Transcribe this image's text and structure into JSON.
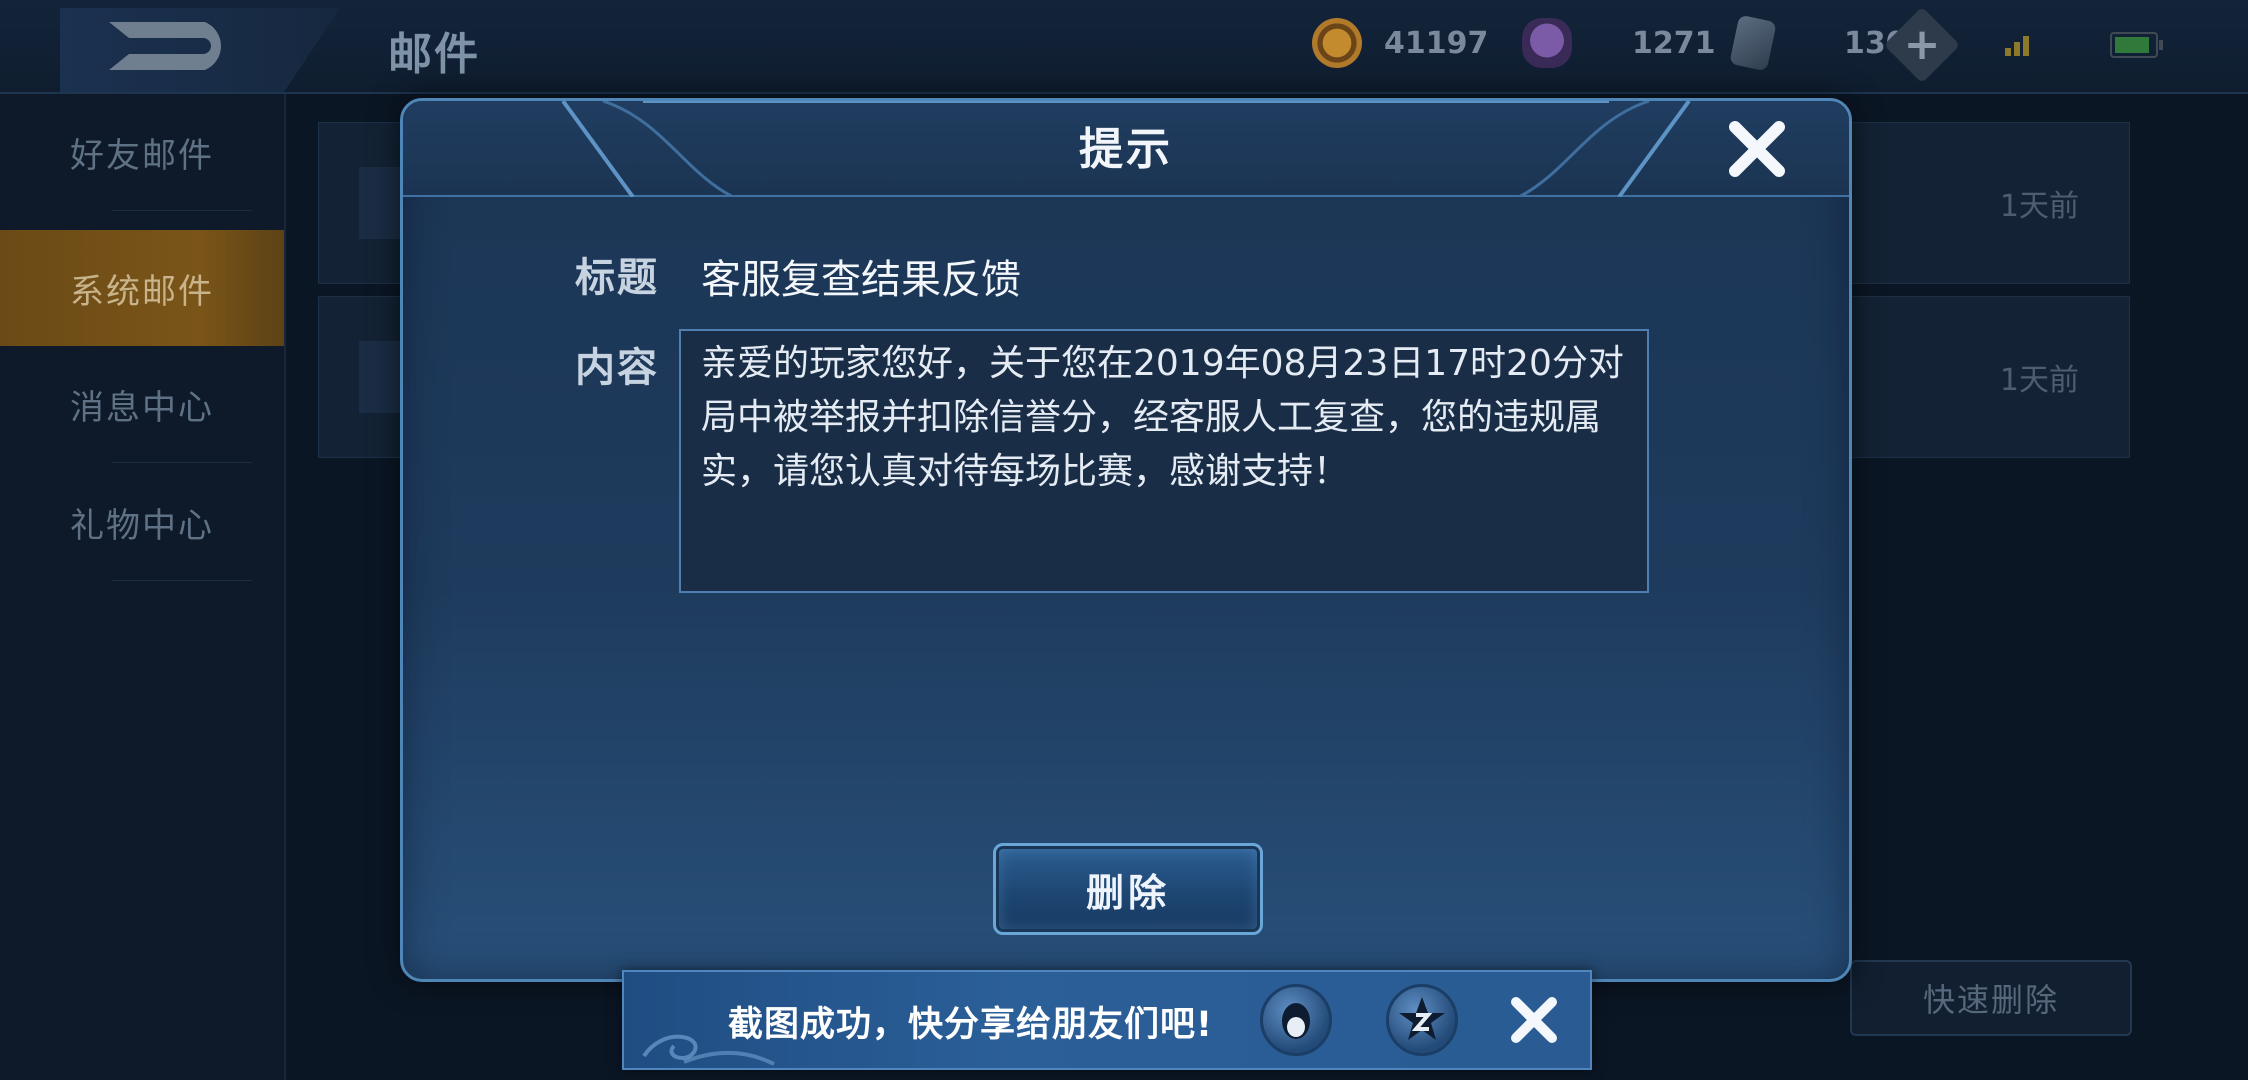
{
  "topbar": {
    "page_title": "邮件",
    "currencies": [
      {
        "icon": "gold-coin-icon",
        "value": "41197"
      },
      {
        "icon": "diamond-icon",
        "value": "1271"
      },
      {
        "icon": "card-icon",
        "value": "130"
      }
    ]
  },
  "sidebar": {
    "items": [
      {
        "label": "好友邮件",
        "active": false
      },
      {
        "label": "系统邮件",
        "active": true
      },
      {
        "label": "消息中心",
        "active": false
      },
      {
        "label": "礼物中心",
        "active": false
      }
    ]
  },
  "mail_list": {
    "rows": [
      {
        "time": "1天前"
      },
      {
        "time": "1天前"
      }
    ],
    "quick_delete_label": "快速删除"
  },
  "dialog": {
    "title": "提示",
    "subject_label": "标题",
    "subject_value": "客服复查结果反馈",
    "content_label": "内容",
    "content_text": "亲爱的玩家您好，关于您在2019年08月23日17时20分对局中被举报并扣除信誉分，经客服人工复查，您的违规属实，请您认真对待每场比赛，感谢支持！",
    "delete_label": "删除"
  },
  "share_toast": {
    "text": "截图成功，快分享给朋友们吧!",
    "buttons": [
      "qq-icon",
      "qzone-icon"
    ]
  },
  "colors": {
    "dialog_border": "#4e86b8",
    "sidebar_active": "#7a5518",
    "share_bar": "#2b5f98"
  }
}
